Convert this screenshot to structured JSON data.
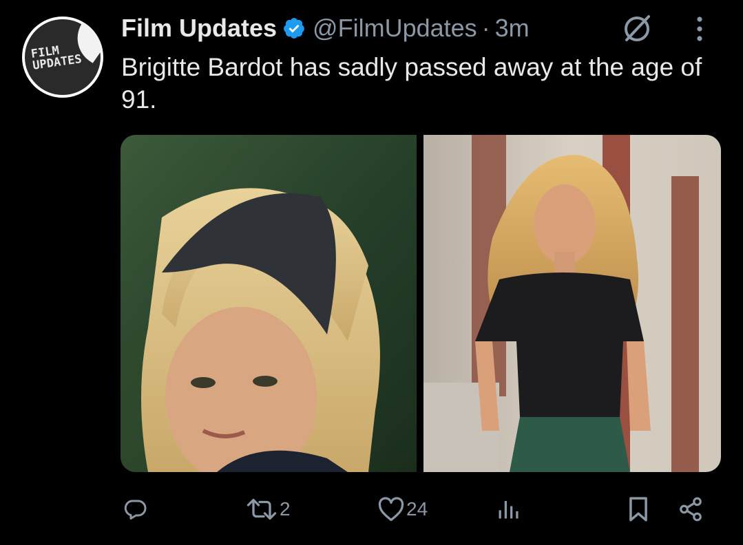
{
  "author": {
    "name": "Film Updates",
    "handle": "@FilmUpdates",
    "separator": "·",
    "time": "3m",
    "verified": true,
    "avatar_logo": [
      "FILM",
      "UPDATES"
    ]
  },
  "tweet": {
    "text": "Brigitte Bardot has sadly passed away at the age of 91."
  },
  "media": [
    {
      "kind": "photo",
      "position": "left"
    },
    {
      "kind": "photo",
      "position": "right"
    }
  ],
  "actions": {
    "reply_count": "",
    "retweet_count": "2",
    "like_count": "24",
    "views_count": ""
  },
  "colors": {
    "background": "#000000",
    "text": "#e7e9ea",
    "secondary": "#8b98a5",
    "verified": "#1d9bf0"
  },
  "icons": [
    "verified-badge-icon",
    "grok-icon",
    "more-icon",
    "reply-icon",
    "retweet-icon",
    "like-icon",
    "views-icon",
    "bookmark-icon",
    "share-icon"
  ]
}
